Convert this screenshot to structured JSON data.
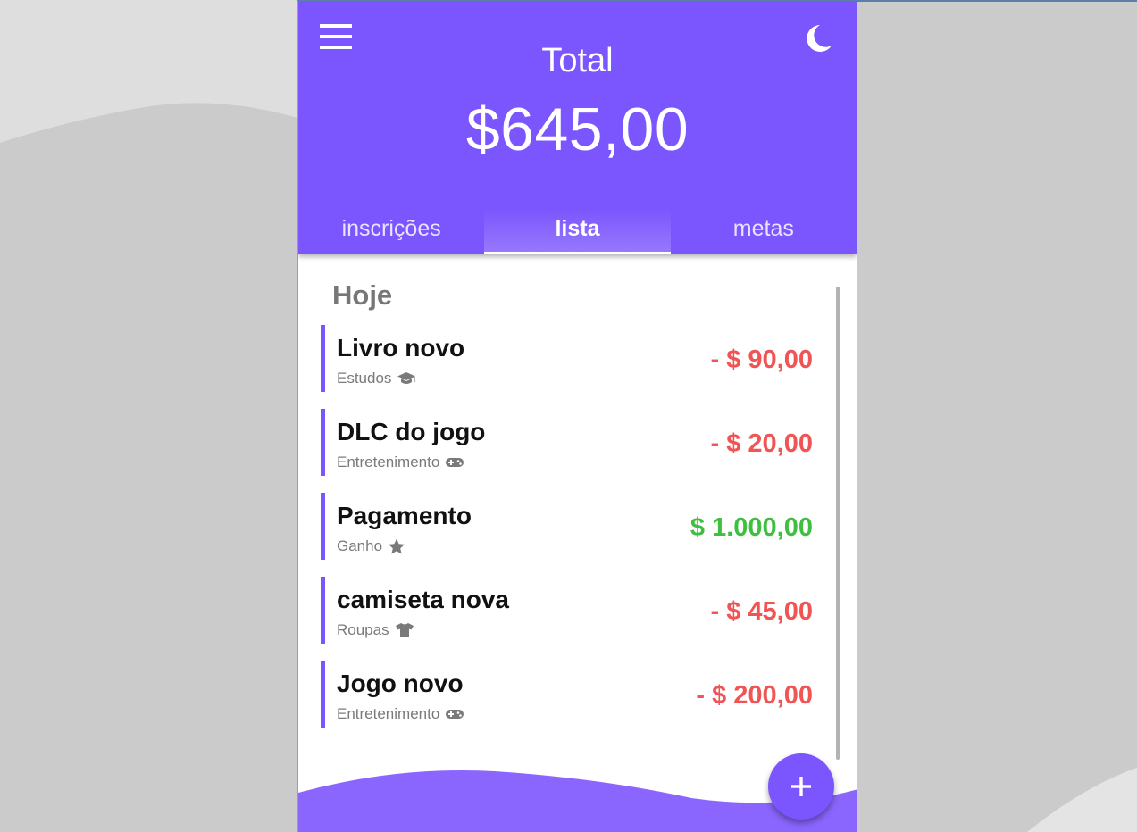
{
  "header": {
    "total_label": "Total",
    "total_value": "$645,00",
    "menu_icon": "hamburger-menu-icon",
    "theme_icon": "moon-icon"
  },
  "tabs": [
    {
      "label": "inscrições",
      "active": false
    },
    {
      "label": "lista",
      "active": true
    },
    {
      "label": "metas",
      "active": false
    }
  ],
  "list": {
    "section_title": "Hoje",
    "items": [
      {
        "title": "Livro novo",
        "category": "Estudos",
        "icon": "graduation-cap-icon",
        "amount": "- $ 90,00",
        "type": "expense"
      },
      {
        "title": "DLC do jogo",
        "category": "Entretenimento",
        "icon": "gamepad-icon",
        "amount": "- $ 20,00",
        "type": "expense"
      },
      {
        "title": "Pagamento",
        "category": "Ganho",
        "icon": "star-icon",
        "amount": "$ 1.000,00",
        "type": "income"
      },
      {
        "title": "camiseta nova",
        "category": "Roupas",
        "icon": "tshirt-icon",
        "amount": "- $ 45,00",
        "type": "expense"
      },
      {
        "title": "Jogo novo",
        "category": "Entretenimento",
        "icon": "gamepad-icon",
        "amount": "- $ 200,00",
        "type": "expense"
      }
    ]
  },
  "fab": {
    "icon": "plus-icon"
  },
  "colors": {
    "accent": "#7b55fd",
    "expense": "#f05454",
    "income": "#3fbf3f",
    "background": "#cbcbcb"
  }
}
